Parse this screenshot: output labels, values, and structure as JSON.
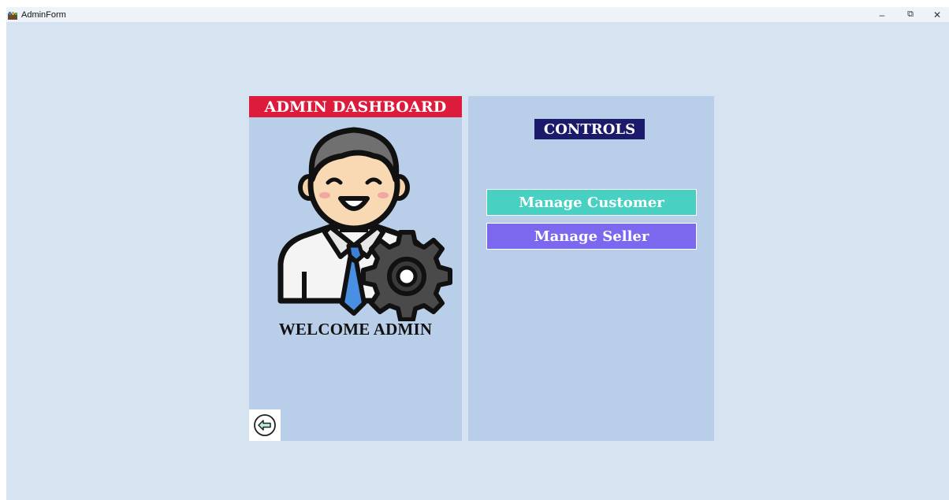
{
  "window": {
    "title": "AdminForm",
    "minimize_glyph": "–",
    "restore_glyph": "⧉",
    "close_glyph": "✕"
  },
  "left_panel": {
    "header": "ADMIN DASHBOARD",
    "welcome": "WELCOME ADMIN",
    "avatar_icon": "admin-settings-icon",
    "back_icon": "back-arrow-icon"
  },
  "right_panel": {
    "title": "CONTROLS",
    "buttons": [
      {
        "label": "Manage Customer",
        "color": "#48d1c2"
      },
      {
        "label": "Manage Seller",
        "color": "#7b68ee"
      }
    ]
  },
  "colors": {
    "background": "#d6e3f1",
    "panel": "#b9cfe9",
    "header_red": "#dd1b3d",
    "controls_navy": "#1c1b6b"
  }
}
